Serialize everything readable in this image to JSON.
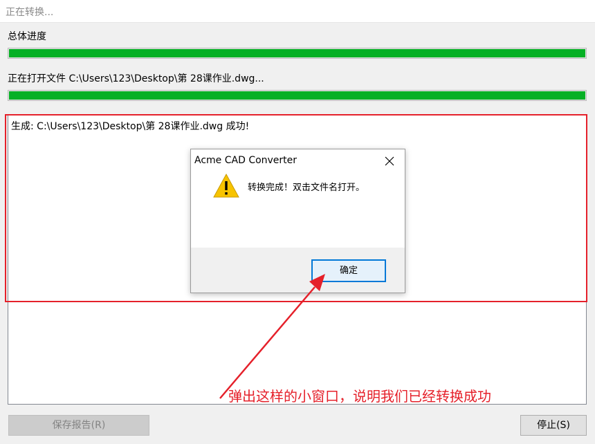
{
  "window": {
    "title": "正在转换..."
  },
  "overall": {
    "label": "总体进度",
    "progress": 1.0
  },
  "file": {
    "label": "正在打开文件 C:\\Users\\123\\Desktop\\第 28课作业.dwg...",
    "progress": 1.0
  },
  "log": {
    "lines": [
      "生成: C:\\Users\\123\\Desktop\\第 28课作业.dwg 成功!"
    ]
  },
  "buttons": {
    "save_report": "保存报告(R)",
    "stop": "停止(S)"
  },
  "dialog": {
    "title": "Acme CAD Converter",
    "close_icon": "close-icon",
    "warning_icon": "warning-icon",
    "message": "转换完成！双击文件名打开。",
    "ok_label": "确定"
  },
  "annotation": {
    "text": "弹出这样的小窗口，说明我们已经转换成功",
    "color": "#e5202a"
  },
  "colors": {
    "progress_fill": "#06b025",
    "dialog_button_border": "#0078d7"
  }
}
